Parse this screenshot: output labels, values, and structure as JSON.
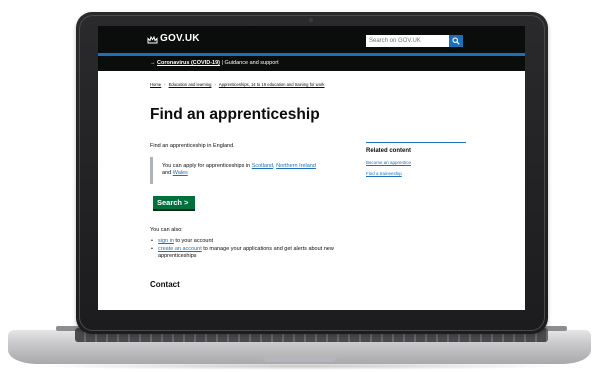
{
  "header": {
    "logo": "GOV.UK",
    "search_placeholder": "Search on GOV.UK"
  },
  "covid_banner": {
    "arrow": "→",
    "link_text": "Coronavirus (COVID-19)",
    "separator": "|",
    "rest_text": "Guidance and support"
  },
  "breadcrumb": {
    "items": [
      "Home",
      "Education and learning",
      "Apprenticeships, 14 to 19 education and training for work"
    ],
    "separator": "›"
  },
  "main": {
    "title": "Find an apprenticeship",
    "lead": "Find an apprenticeship in England.",
    "inset": {
      "text_before": "You can apply for apprenticeships in ",
      "link_scotland": "Scotland",
      "comma": ", ",
      "link_ni": "Northern Ireland",
      "and": " and ",
      "link_wales": "Wales"
    },
    "start_button": "Search",
    "start_button_chevron": ">",
    "can_also": "You can also:",
    "bullet1_link": "sign in",
    "bullet1_text": " to your account",
    "bullet2_link": "create an account",
    "bullet2_text": " to manage your applications and get alerts about new apprenticeships",
    "contact_heading": "Contact"
  },
  "related": {
    "title": "Related content",
    "links": [
      "Become an apprentice",
      "Find a traineeship"
    ]
  },
  "colors": {
    "header_bg": "#0b0c0c",
    "brand_blue": "#1d70b8",
    "button_green": "#00703c",
    "link": "#1d70b8"
  }
}
